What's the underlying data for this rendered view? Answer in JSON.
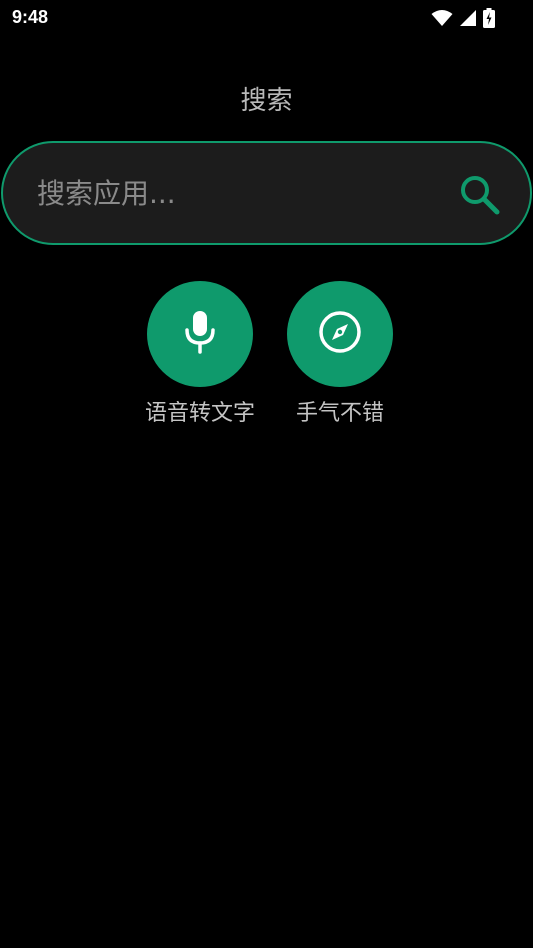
{
  "status_bar": {
    "time": "9:48",
    "icons": [
      "wifi-icon",
      "signal-icon",
      "battery-charging-icon"
    ]
  },
  "header": {
    "title": "搜索"
  },
  "search": {
    "placeholder": "搜索应用...",
    "value": "",
    "icon": "search-icon"
  },
  "actions": [
    {
      "label": "语音转文字",
      "icon": "microphone-icon"
    },
    {
      "label": "手气不错",
      "icon": "compass-icon"
    }
  ],
  "colors": {
    "background": "#000000",
    "accent": "#0f9a6c",
    "search_bg": "#1c1c1c",
    "title_text": "#b9b9b9",
    "label_text": "#c4c4c4"
  }
}
